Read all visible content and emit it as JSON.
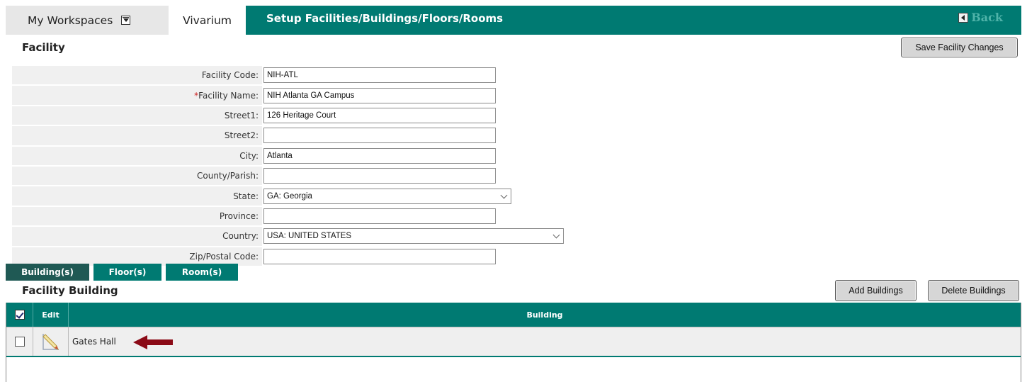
{
  "header": {
    "workspaces_label": "My Workspaces",
    "active_tab_label": "Vivarium",
    "page_title": "Setup Facilities/Buildings/Floors/Rooms",
    "back_label": "Back"
  },
  "facility": {
    "section_title": "Facility",
    "save_button_label": "Save Facility Changes",
    "fields": [
      {
        "label": "Facility Code:",
        "value": "NIH-ATL"
      },
      {
        "label": "Facility Name:",
        "value": "NIH Atlanta GA Campus",
        "required_mark": "*"
      },
      {
        "label": "Street1:",
        "value": "126 Heritage Court"
      },
      {
        "label": "Street2:",
        "value": ""
      },
      {
        "label": "City:",
        "value": "Atlanta"
      },
      {
        "label": "County/Parish:",
        "value": ""
      },
      {
        "label": "State:",
        "value": "GA: Georgia"
      },
      {
        "label": "Province:",
        "value": ""
      },
      {
        "label": "Country:",
        "value": "USA: UNITED STATES"
      },
      {
        "label": "Zip/Postal Code:",
        "value": ""
      }
    ]
  },
  "subtabs": [
    {
      "label": "Building(s)",
      "active": true
    },
    {
      "label": "Floor(s)",
      "active": false
    },
    {
      "label": "Room(s)",
      "active": false
    }
  ],
  "building_section": {
    "title": "Facility Building",
    "add_button_label": "Add Buildings",
    "delete_button_label": "Delete Buildings",
    "grid": {
      "headers": {
        "edit": "Edit",
        "building": "Building"
      },
      "rows": [
        {
          "building": "Gates Hall",
          "checked": false
        }
      ]
    }
  },
  "icons": {
    "select_all": "checklist-icon",
    "edit": "pencil-icon",
    "back": "back-arrow-icon",
    "annotation": "red-arrow-icon"
  },
  "colors": {
    "accent": "#007a72",
    "active_subtab": "#1f5954",
    "required": "#cc2222",
    "annotation_arrow": "#8b0a16",
    "back_text": "#4fb3a9"
  }
}
